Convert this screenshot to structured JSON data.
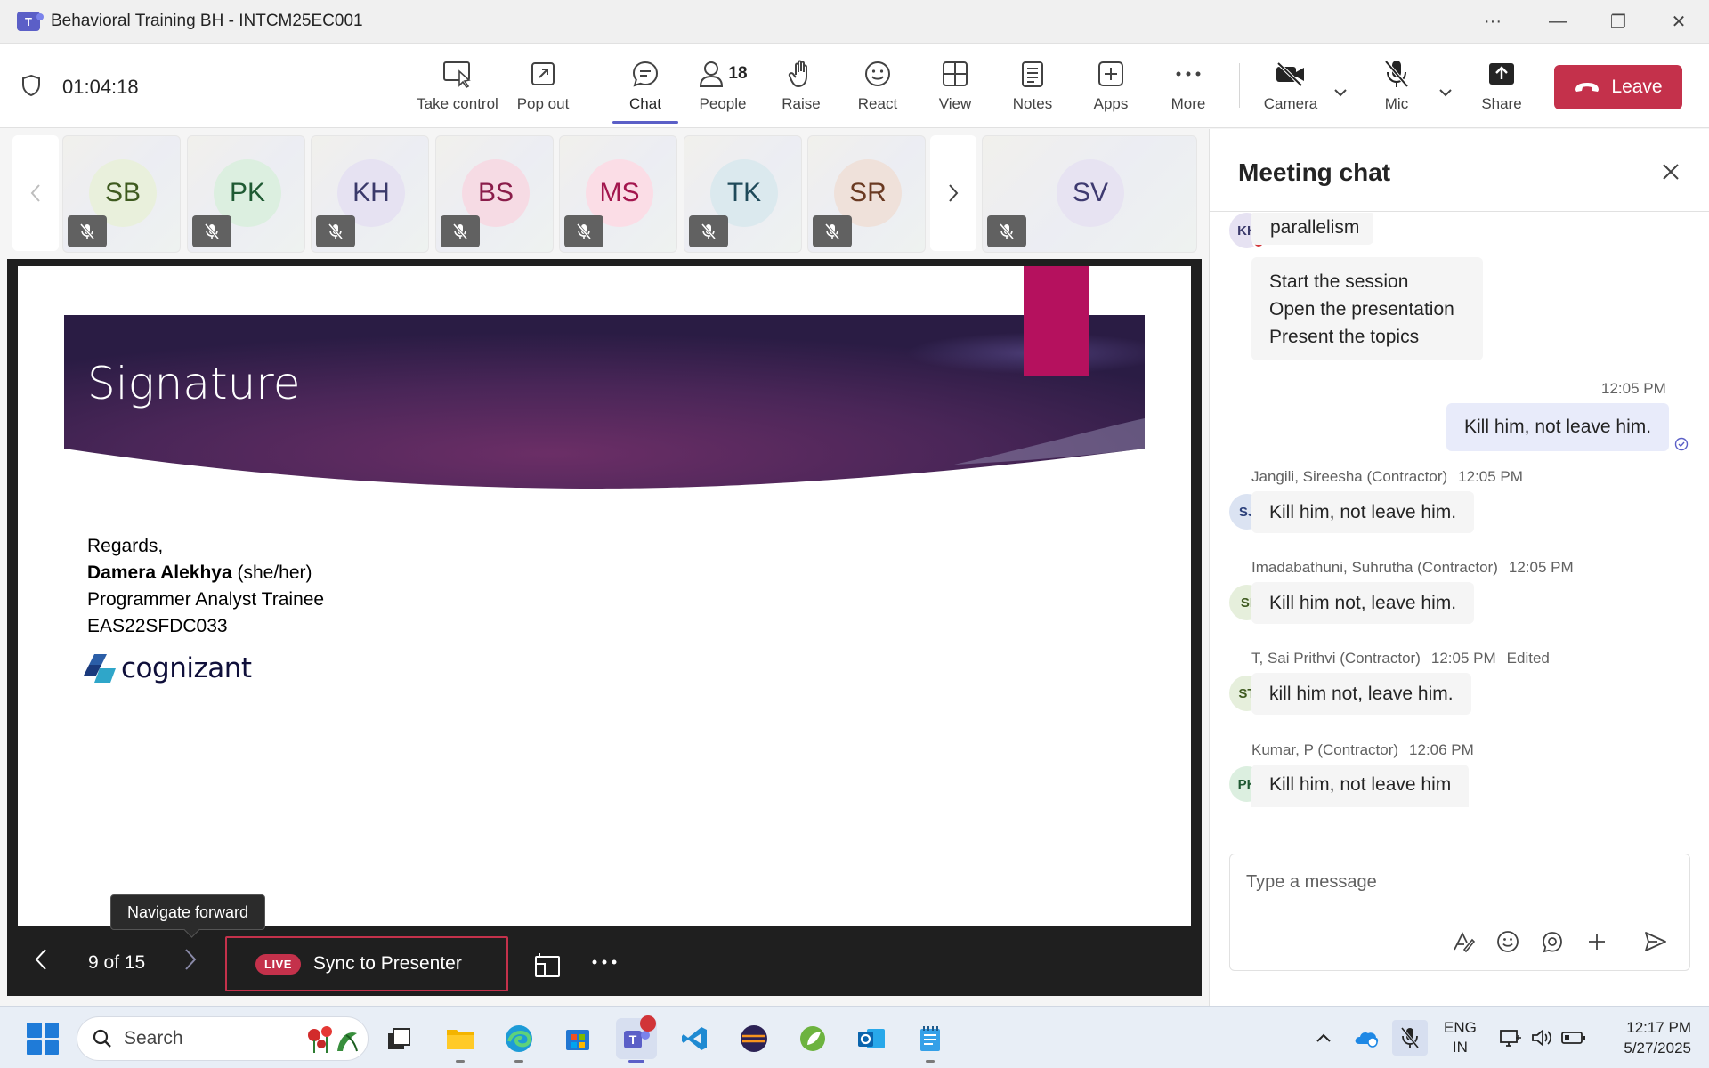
{
  "window": {
    "title": "Behavioral Training BH - INTCM25EC001",
    "app_icon_letter": "T",
    "controls": {
      "more": "···",
      "minimize": "—",
      "restore": "❐",
      "close": "✕"
    }
  },
  "toolbar": {
    "timer": "01:04:18",
    "take_control": "Take control",
    "pop_out": "Pop out",
    "chat": "Chat",
    "people": "People",
    "people_count": "18",
    "raise": "Raise",
    "react": "React",
    "view": "View",
    "notes": "Notes",
    "apps": "Apps",
    "more": "More",
    "camera": "Camera",
    "mic": "Mic",
    "share": "Share",
    "leave": "Leave"
  },
  "participants": [
    {
      "initials": "SB",
      "color": "#e9f0dc",
      "text": "#3e5a1f"
    },
    {
      "initials": "PK",
      "color": "#dcefe0",
      "text": "#1f5a33"
    },
    {
      "initials": "KH",
      "color": "#e6e2f2",
      "text": "#3b3a6b"
    },
    {
      "initials": "BS",
      "color": "#f6dbe4",
      "text": "#8a1d4a"
    },
    {
      "initials": "MS",
      "color": "#fbdde6",
      "text": "#a3164e"
    },
    {
      "initials": "TK",
      "color": "#dbe9ee",
      "text": "#1f4a5a"
    },
    {
      "initials": "SR",
      "color": "#efe1da",
      "text": "#6a3a22"
    },
    {
      "initials": "SV",
      "color": "#e7e3f2",
      "text": "#3e3a70"
    }
  ],
  "slide": {
    "title": "Signature",
    "regards": "Regards,",
    "name": "Damera Alekhya",
    "pronouns": " (she/her)",
    "role": "Programmer Analyst Trainee",
    "emp_id": "EAS22SFDC033",
    "logo_text": "cognizant"
  },
  "stage_controls": {
    "page": "9 of 15",
    "live_badge": "LIVE",
    "sync": "Sync to Presenter",
    "tooltip": "Navigate forward"
  },
  "chat": {
    "title": "Meeting chat",
    "messages": [
      {
        "avatar": "KH",
        "text": "parallelism"
      },
      {
        "lines": [
          "Start the session",
          "Open the presentation",
          "Present the topics"
        ]
      },
      {
        "time": "12:05 PM",
        "text": "Kill him, not leave him.",
        "mine": true
      },
      {
        "sender": "Jangili, Sireesha (Contractor)",
        "time": "12:05 PM",
        "avatar": "SJ",
        "text": "Kill him, not leave him."
      },
      {
        "sender": "Imadabathuni, Suhrutha (Contractor)",
        "time": "12:05 PM",
        "avatar": "SI",
        "text": "Kill him not, leave him."
      },
      {
        "sender": "T, Sai Prithvi (Contractor)",
        "time": "12:05 PM",
        "edited": "Edited",
        "avatar": "ST",
        "text": "kill him not, leave him."
      },
      {
        "sender": "Kumar, P (Contractor)",
        "time": "12:06 PM",
        "avatar": "PK",
        "text": "Kill him, not leave him"
      }
    ],
    "compose_placeholder": "Type a message"
  },
  "taskbar": {
    "search": "Search",
    "lang_top": "ENG",
    "lang_bottom": "IN",
    "time": "12:17 PM",
    "date": "5/27/2025"
  }
}
